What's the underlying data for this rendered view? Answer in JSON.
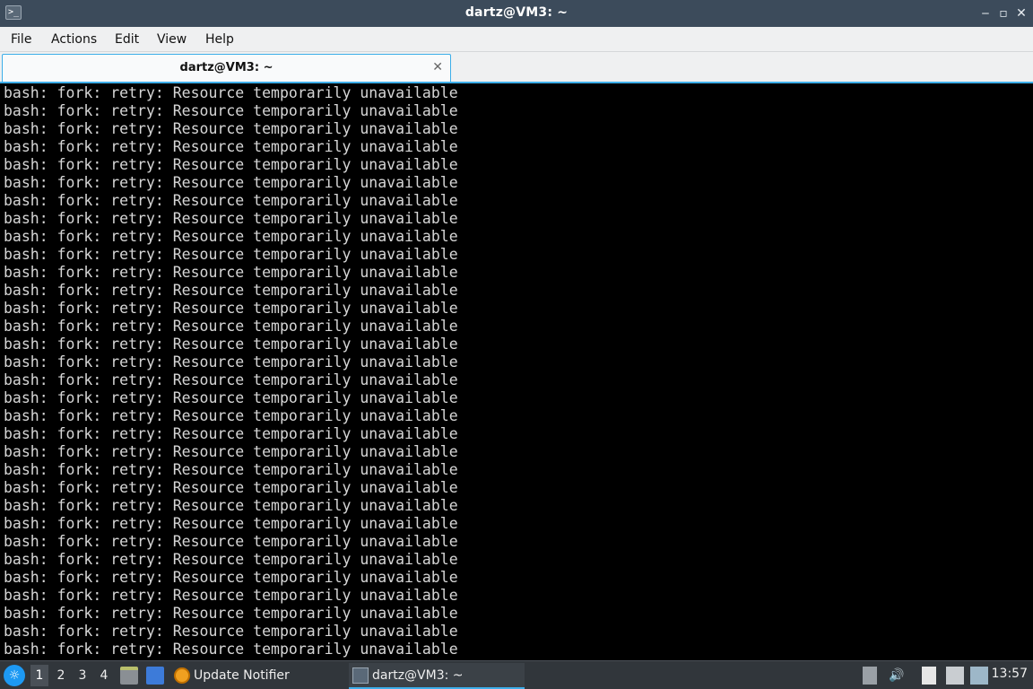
{
  "window": {
    "title": "dartz@VM3: ~",
    "app_icon": "terminal-icon",
    "controls": [
      "minimize",
      "maximize",
      "close"
    ]
  },
  "menubar": {
    "items": [
      "File",
      "Actions",
      "Edit",
      "View",
      "Help"
    ]
  },
  "tabs": [
    {
      "label": "dartz@VM3: ~",
      "active": true
    }
  ],
  "terminal": {
    "line_text": "bash: fork: retry: Resource temporarily unavailable",
    "line_count": 32
  },
  "taskbar": {
    "workspaces": [
      "1",
      "2",
      "3",
      "4"
    ],
    "active_workspace": "1",
    "tasks": [
      {
        "label": "Update Notifier",
        "icon": "update-notifier-icon",
        "active": false
      },
      {
        "label": "dartz@VM3: ~",
        "icon": "terminal-icon",
        "active": true
      }
    ],
    "clock": "13:57"
  },
  "colors": {
    "titlebar": "#3c4b5b",
    "accent": "#3daee9",
    "terminal_bg": "#000000",
    "terminal_fg": "#d6d6d6",
    "taskbar": "#31363b"
  }
}
